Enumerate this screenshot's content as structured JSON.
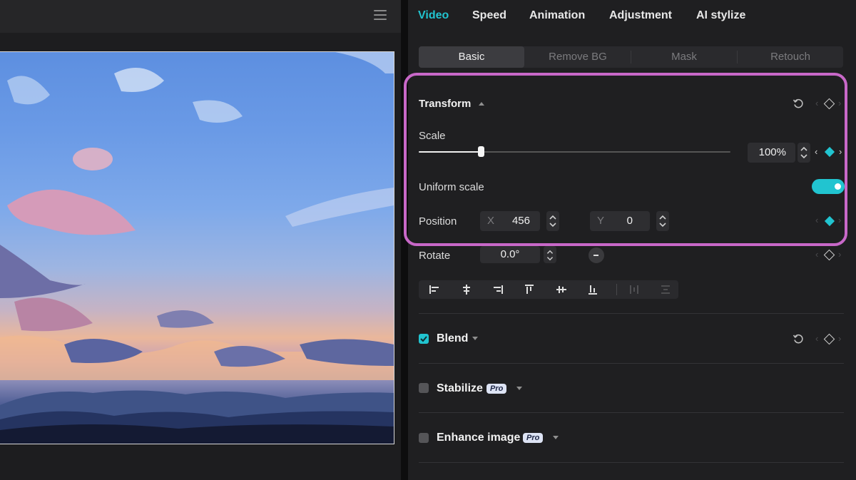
{
  "main_tabs": [
    {
      "label": "Video",
      "active": true
    },
    {
      "label": "Speed",
      "active": false
    },
    {
      "label": "Animation",
      "active": false
    },
    {
      "label": "Adjustment",
      "active": false
    },
    {
      "label": "AI stylize",
      "active": false
    }
  ],
  "sub_tabs": [
    {
      "label": "Basic",
      "active": true
    },
    {
      "label": "Remove BG",
      "active": false
    },
    {
      "label": "Mask",
      "active": false
    },
    {
      "label": "Retouch",
      "active": false
    }
  ],
  "transform": {
    "title": "Transform",
    "scale": {
      "label": "Scale",
      "value": "100%",
      "slider_fraction": 0.2
    },
    "uniform_scale": {
      "label": "Uniform scale",
      "enabled": true
    },
    "position": {
      "label": "Position",
      "x_label": "X",
      "x_value": "456",
      "y_label": "Y",
      "y_value": "0"
    },
    "rotate": {
      "label": "Rotate",
      "value": "0.0°"
    }
  },
  "align_icons": [
    "align-left-icon",
    "align-center-horizontal-icon",
    "align-right-icon",
    "align-top-icon",
    "align-center-vertical-icon",
    "align-bottom-icon",
    "distribute-horizontal-icon",
    "distribute-vertical-icon"
  ],
  "sections": [
    {
      "label": "Blend",
      "checked": true,
      "pro": false
    },
    {
      "label": "Stabilize",
      "checked": false,
      "pro": true,
      "pro_label": "Pro"
    },
    {
      "label": "Enhance image",
      "checked": false,
      "pro": true,
      "pro_label": "Pro"
    }
  ],
  "colors": {
    "accent": "#21c4d0",
    "highlight": "#c868c8",
    "panel": "#1f1f21"
  }
}
